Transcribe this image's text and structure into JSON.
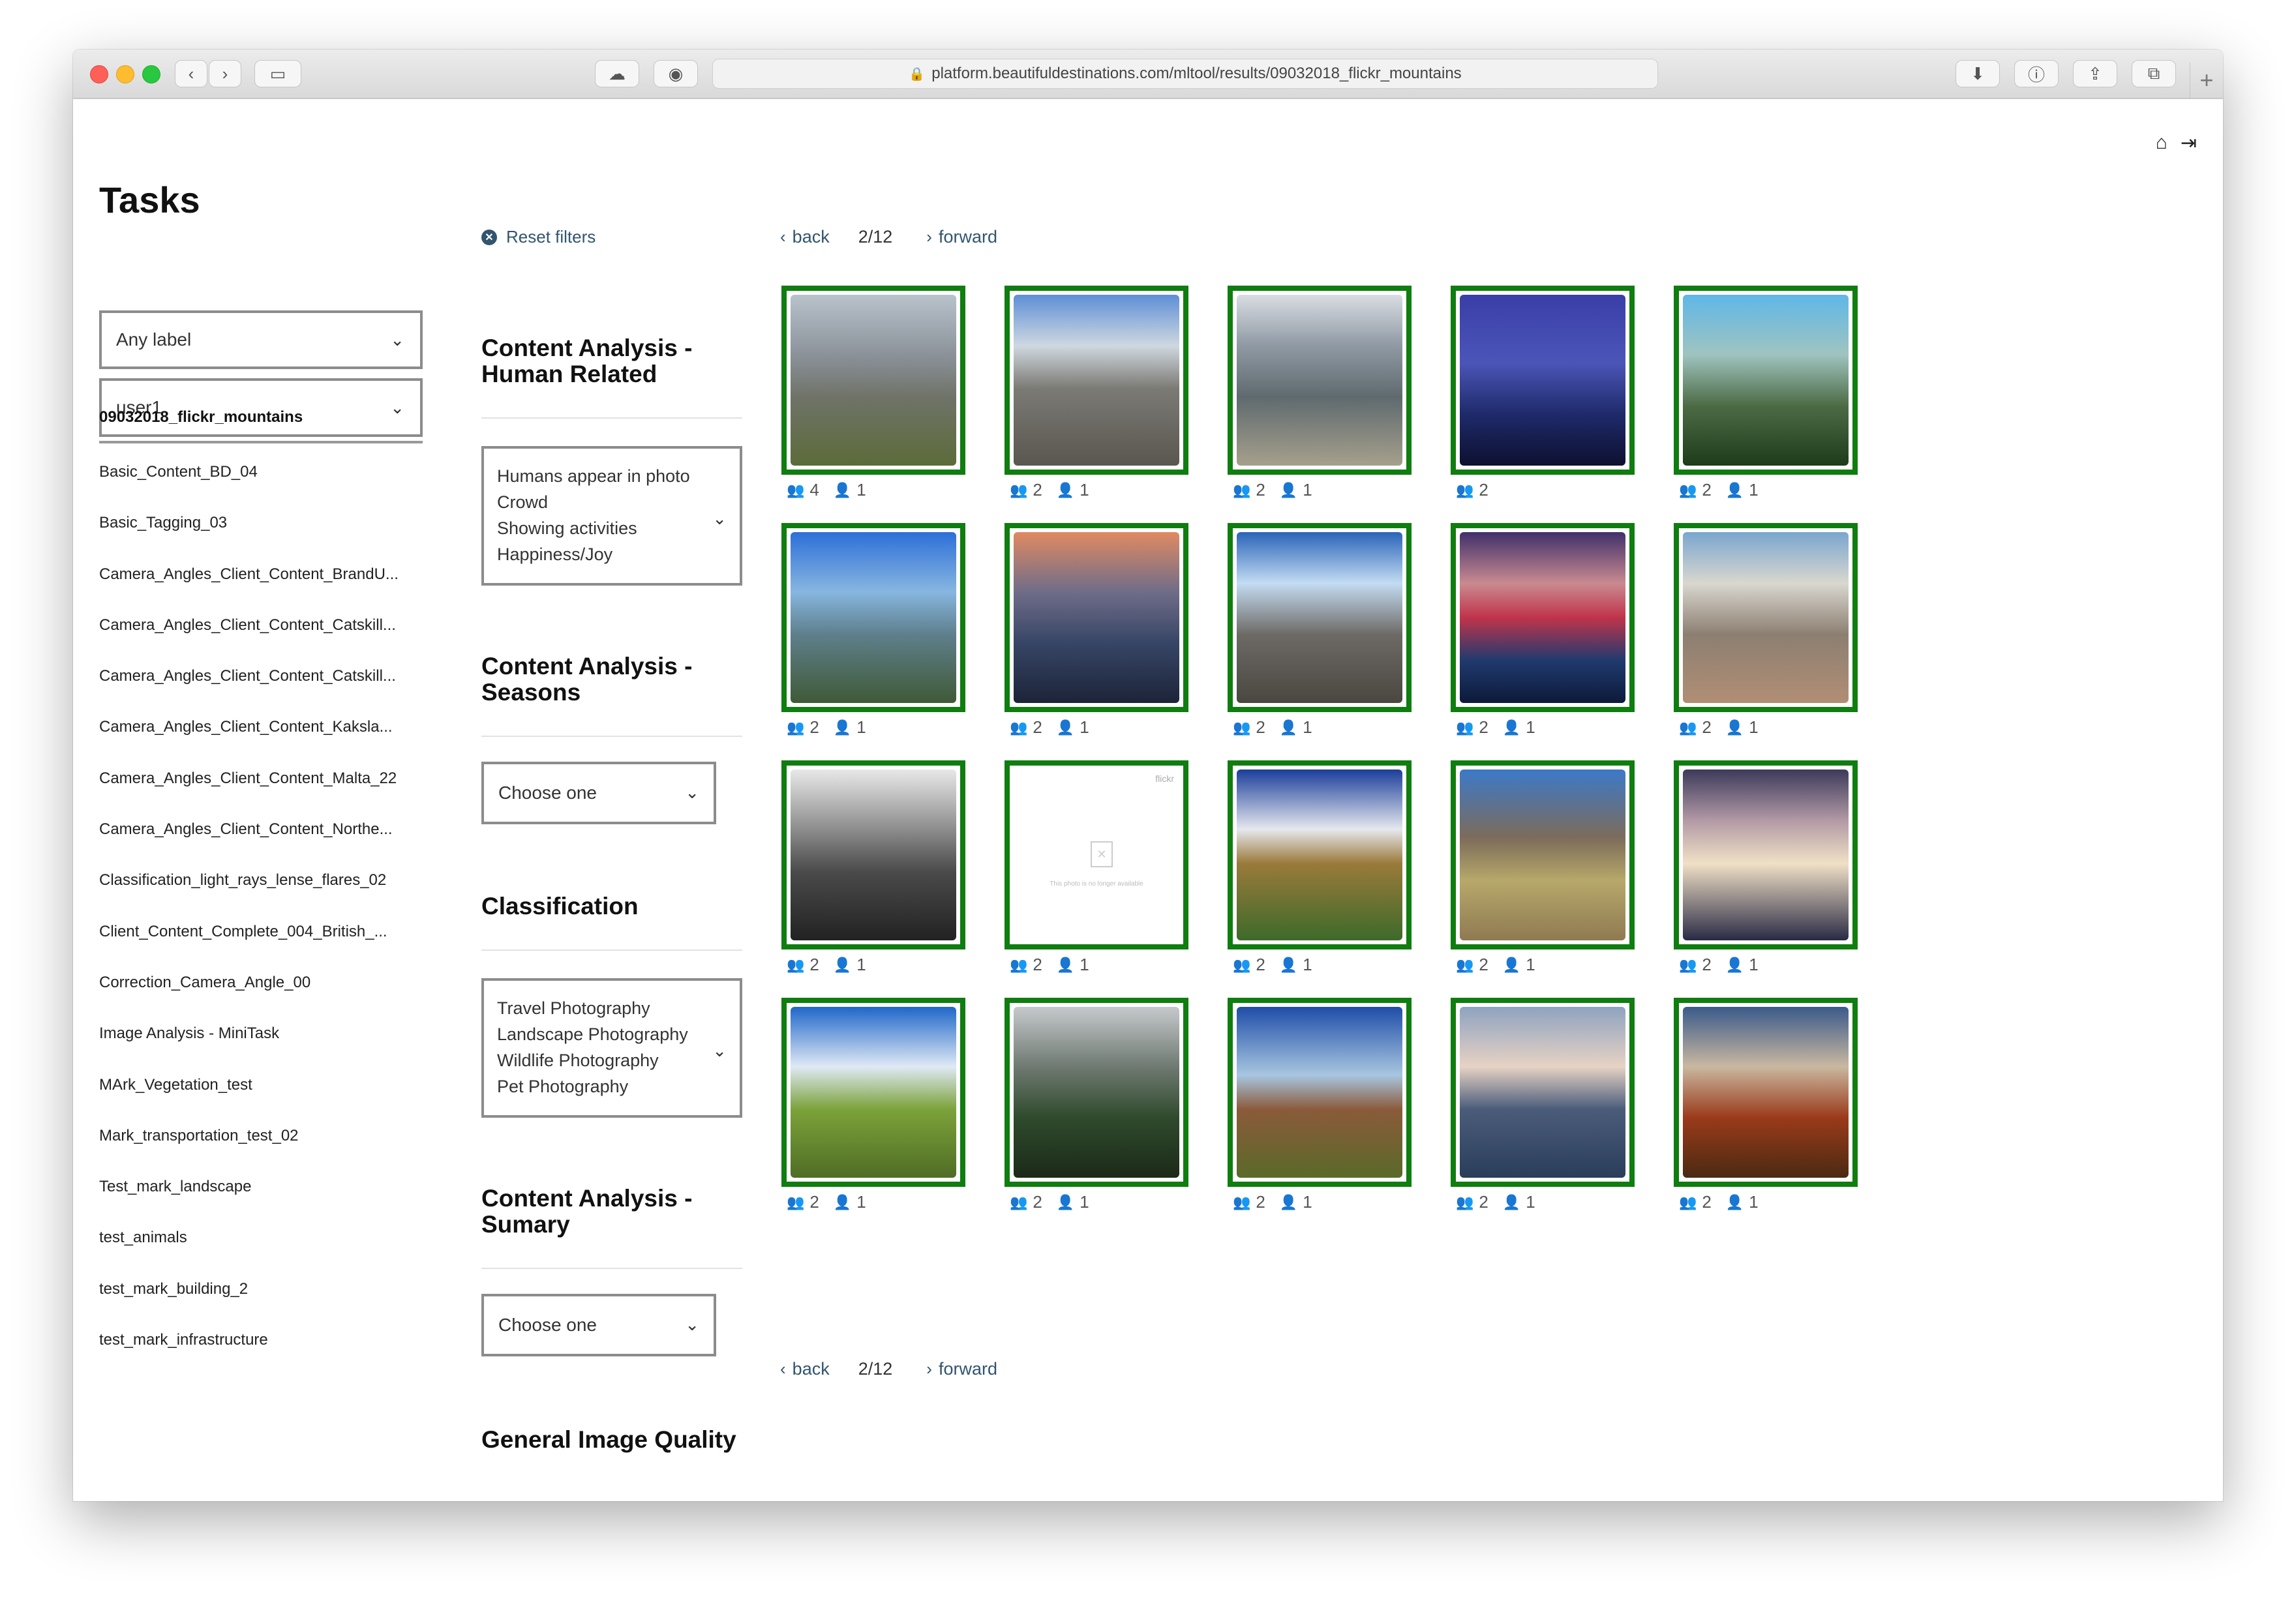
{
  "browser": {
    "url": "platform.beautifuldestinations.com/mltool/results/09032018_flickr_mountains"
  },
  "tasks": {
    "title": "Tasks",
    "label_select": "Any label",
    "user_select": "user1",
    "active_task": "09032018_flickr_mountains",
    "items": [
      "Basic_Content_BD_04",
      "Basic_Tagging_03",
      "Camera_Angles_Client_Content_BrandU...",
      "Camera_Angles_Client_Content_Catskill...",
      "Camera_Angles_Client_Content_Catskill...",
      "Camera_Angles_Client_Content_Kaksla...",
      "Camera_Angles_Client_Content_Malta_22",
      "Camera_Angles_Client_Content_Northe...",
      "Classification_light_rays_lense_flares_02",
      "Client_Content_Complete_004_British_...",
      "Correction_Camera_Angle_00",
      "Image Analysis - MiniTask",
      "MArk_Vegetation_test",
      "Mark_transportation_test_02",
      "Test_mark_landscape",
      "test_animals",
      "test_mark_building_2",
      "test_mark_infrastructure"
    ]
  },
  "filters": {
    "reset_label": "Reset filters",
    "human_related": {
      "title": "Content Analysis - Human Related",
      "options": [
        "Humans appear in photo",
        "Crowd",
        "Showing activities",
        "Happiness/Joy"
      ]
    },
    "seasons": {
      "title": "Content Analysis - Seasons",
      "placeholder": "Choose one"
    },
    "classification": {
      "title": "Classification",
      "options": [
        "Travel Photography",
        "Landscape Photography",
        "Wildlife Photography",
        "Pet Photography"
      ]
    },
    "summary": {
      "title": "Content Analysis - Sumary",
      "placeholder": "Choose one"
    },
    "quality": {
      "title": "General Image Quality"
    }
  },
  "pager": {
    "back": "back",
    "page": "2/12",
    "forward": "forward"
  },
  "results": [
    {
      "group": "4",
      "user": "1"
    },
    {
      "group": "2",
      "user": "1"
    },
    {
      "group": "2",
      "user": "1"
    },
    {
      "group": "2",
      "user": ""
    },
    {
      "group": "2",
      "user": "1"
    },
    {
      "group": "2",
      "user": "1"
    },
    {
      "group": "2",
      "user": "1"
    },
    {
      "group": "2",
      "user": "1"
    },
    {
      "group": "2",
      "user": "1"
    },
    {
      "group": "2",
      "user": "1"
    },
    {
      "group": "2",
      "user": "1"
    },
    {
      "group": "2",
      "user": "1"
    },
    {
      "group": "2",
      "user": "1"
    },
    {
      "group": "2",
      "user": "1"
    },
    {
      "group": "2",
      "user": "1"
    },
    {
      "group": "2",
      "user": "1"
    },
    {
      "group": "2",
      "user": "1"
    },
    {
      "group": "2",
      "user": "1"
    },
    {
      "group": "2",
      "user": "1"
    },
    {
      "group": "2",
      "user": "1"
    }
  ],
  "placeholder_image": {
    "brand": "flickr",
    "message": "This photo is no longer available"
  },
  "colors": {
    "thumb_border": "#0f7d0f",
    "link": "#31556e"
  }
}
